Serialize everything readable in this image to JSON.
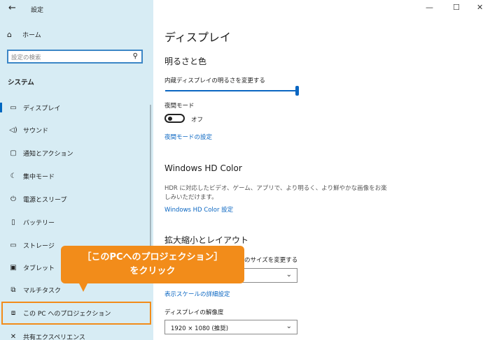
{
  "window": {
    "title": "設定",
    "back_glyph": "←",
    "minimize": "—",
    "maximize": "☐",
    "close": "✕"
  },
  "sidebar": {
    "home_label": "ホーム",
    "search_placeholder": "設定の検索",
    "section_title": "システム",
    "items": [
      {
        "label": "ディスプレイ",
        "icon": "monitor-icon",
        "glyph": "▭"
      },
      {
        "label": "サウンド",
        "icon": "speaker-icon",
        "glyph": "🔈"
      },
      {
        "label": "通知とアクション",
        "icon": "notification-icon",
        "glyph": "▢"
      },
      {
        "label": "集中モード",
        "icon": "moon-icon",
        "glyph": "☾"
      },
      {
        "label": "電源とスリープ",
        "icon": "power-icon",
        "glyph": "⏻"
      },
      {
        "label": "バッテリー",
        "icon": "battery-icon",
        "glyph": "▯"
      },
      {
        "label": "ストレージ",
        "icon": "storage-icon",
        "glyph": "▭"
      },
      {
        "label": "タブレット",
        "icon": "tablet-icon",
        "glyph": "▣"
      },
      {
        "label": "マルチタスク",
        "icon": "multitask-icon",
        "glyph": "⧉"
      },
      {
        "label": "この PC へのプロジェクション",
        "icon": "projection-icon",
        "glyph": "⧈"
      },
      {
        "label": "共有エクスペリエンス",
        "icon": "share-icon",
        "glyph": "✕"
      }
    ]
  },
  "main": {
    "title": "ディスプレイ",
    "brightness": {
      "heading": "明るさと色",
      "slider_label": "内蔵ディスプレイの明るさを変更する",
      "slider_value": 100,
      "night_label": "夜間モード",
      "night_state": "オフ",
      "night_link": "夜間モードの設定"
    },
    "hdr": {
      "heading": "Windows HD Color",
      "desc": "HDR に対応したビデオ、ゲーム、アプリで、より明るく、より鮮やかな画像をお楽しみいただけます。",
      "link": "Windows HD Color 設定"
    },
    "scale": {
      "heading": "拡大縮小とレイアウト",
      "label": "のサイズを変更する",
      "advanced_link": "表示スケールの詳細設定",
      "resolution_label": "ディスプレイの解像度",
      "resolution_value": "1920 × 1080 (推奨)"
    }
  },
  "callout": {
    "line1": "［このPCへのプロジェクション］",
    "line2": "をクリック",
    "color": "#f28c1a"
  }
}
